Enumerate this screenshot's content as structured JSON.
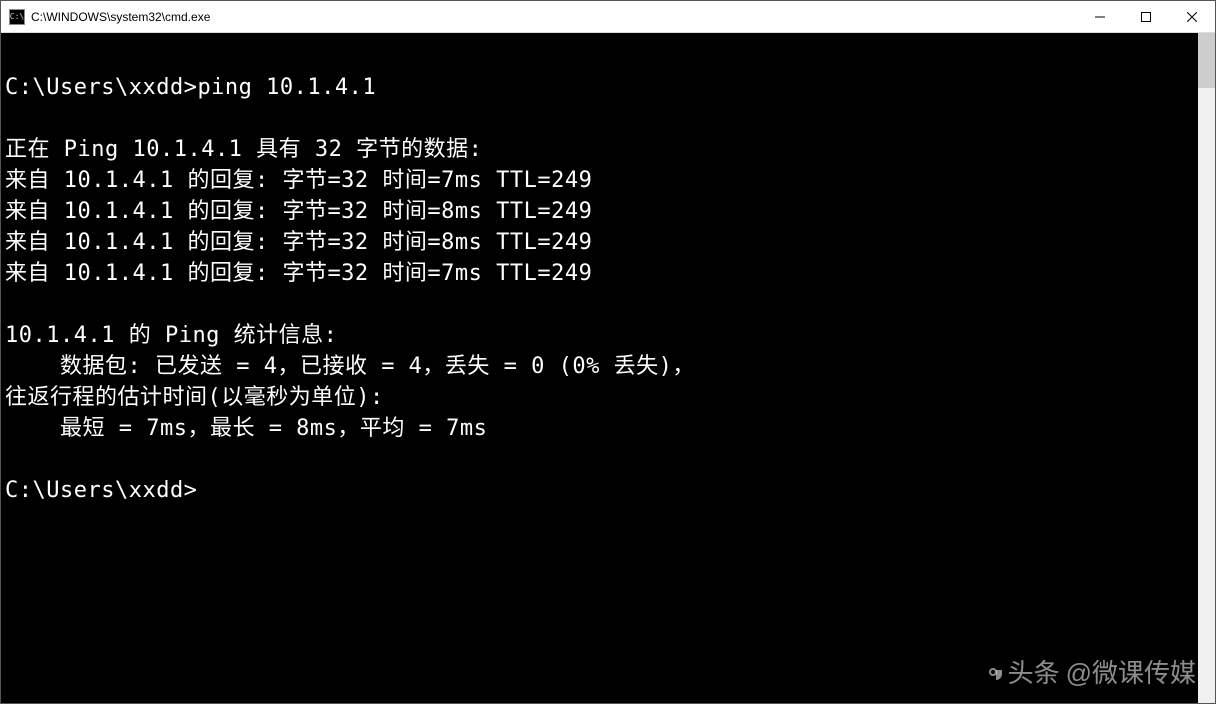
{
  "titlebar": {
    "icon_label": "C:\\",
    "title": "C:\\WINDOWS\\system32\\cmd.exe"
  },
  "terminal": {
    "prompt1": "C:\\Users\\xxdd>",
    "command": "ping 10.1.4.1",
    "blank1": "",
    "ping_header": "正在 Ping 10.1.4.1 具有 32 字节的数据:",
    "replies": [
      "来自 10.1.4.1 的回复: 字节=32 时间=7ms TTL=249",
      "来自 10.1.4.1 的回复: 字节=32 时间=8ms TTL=249",
      "来自 10.1.4.1 的回复: 字节=32 时间=8ms TTL=249",
      "来自 10.1.4.1 的回复: 字节=32 时间=7ms TTL=249"
    ],
    "blank2": "",
    "stats_header": "10.1.4.1 的 Ping 统计信息:",
    "packets_line": "    数据包: 已发送 = 4，已接收 = 4，丢失 = 0 (0% 丢失)，",
    "rtt_header": "往返行程的估计时间(以毫秒为单位):",
    "rtt_line": "    最短 = 7ms，最长 = 8ms，平均 = 7ms",
    "blank3": "",
    "prompt2": "C:\\Users\\xxdd>"
  },
  "watermark": {
    "brand": "头条",
    "handle": "@微课传媒"
  }
}
